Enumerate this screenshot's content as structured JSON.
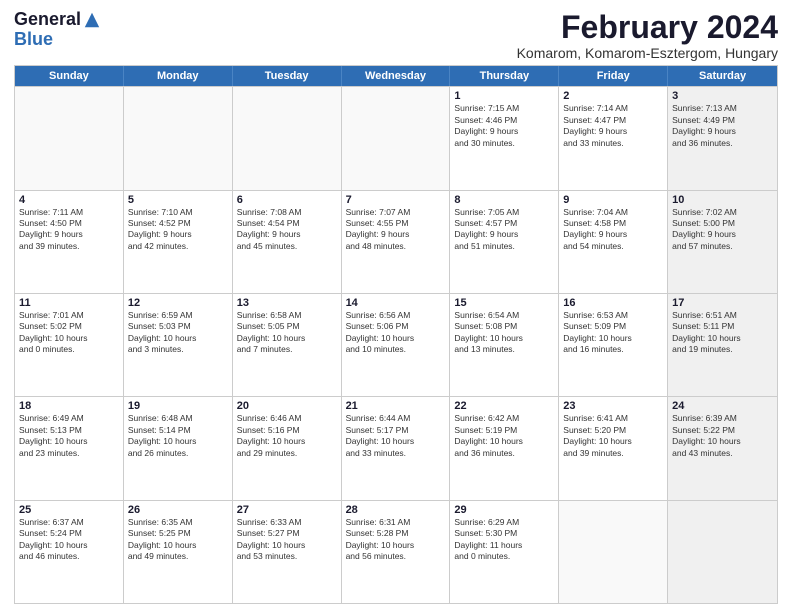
{
  "header": {
    "logo_line1": "General",
    "logo_line2": "Blue",
    "month_title": "February 2024",
    "subtitle": "Komarom, Komarom-Esztergom, Hungary"
  },
  "days_of_week": [
    "Sunday",
    "Monday",
    "Tuesday",
    "Wednesday",
    "Thursday",
    "Friday",
    "Saturday"
  ],
  "rows": [
    [
      {
        "day": "",
        "info": "",
        "empty": true
      },
      {
        "day": "",
        "info": "",
        "empty": true
      },
      {
        "day": "",
        "info": "",
        "empty": true
      },
      {
        "day": "",
        "info": "",
        "empty": true
      },
      {
        "day": "1",
        "info": "Sunrise: 7:15 AM\nSunset: 4:46 PM\nDaylight: 9 hours\nand 30 minutes."
      },
      {
        "day": "2",
        "info": "Sunrise: 7:14 AM\nSunset: 4:47 PM\nDaylight: 9 hours\nand 33 minutes."
      },
      {
        "day": "3",
        "info": "Sunrise: 7:13 AM\nSunset: 4:49 PM\nDaylight: 9 hours\nand 36 minutes.",
        "shaded": true
      }
    ],
    [
      {
        "day": "4",
        "info": "Sunrise: 7:11 AM\nSunset: 4:50 PM\nDaylight: 9 hours\nand 39 minutes."
      },
      {
        "day": "5",
        "info": "Sunrise: 7:10 AM\nSunset: 4:52 PM\nDaylight: 9 hours\nand 42 minutes."
      },
      {
        "day": "6",
        "info": "Sunrise: 7:08 AM\nSunset: 4:54 PM\nDaylight: 9 hours\nand 45 minutes."
      },
      {
        "day": "7",
        "info": "Sunrise: 7:07 AM\nSunset: 4:55 PM\nDaylight: 9 hours\nand 48 minutes."
      },
      {
        "day": "8",
        "info": "Sunrise: 7:05 AM\nSunset: 4:57 PM\nDaylight: 9 hours\nand 51 minutes."
      },
      {
        "day": "9",
        "info": "Sunrise: 7:04 AM\nSunset: 4:58 PM\nDaylight: 9 hours\nand 54 minutes."
      },
      {
        "day": "10",
        "info": "Sunrise: 7:02 AM\nSunset: 5:00 PM\nDaylight: 9 hours\nand 57 minutes.",
        "shaded": true
      }
    ],
    [
      {
        "day": "11",
        "info": "Sunrise: 7:01 AM\nSunset: 5:02 PM\nDaylight: 10 hours\nand 0 minutes."
      },
      {
        "day": "12",
        "info": "Sunrise: 6:59 AM\nSunset: 5:03 PM\nDaylight: 10 hours\nand 3 minutes."
      },
      {
        "day": "13",
        "info": "Sunrise: 6:58 AM\nSunset: 5:05 PM\nDaylight: 10 hours\nand 7 minutes."
      },
      {
        "day": "14",
        "info": "Sunrise: 6:56 AM\nSunset: 5:06 PM\nDaylight: 10 hours\nand 10 minutes."
      },
      {
        "day": "15",
        "info": "Sunrise: 6:54 AM\nSunset: 5:08 PM\nDaylight: 10 hours\nand 13 minutes."
      },
      {
        "day": "16",
        "info": "Sunrise: 6:53 AM\nSunset: 5:09 PM\nDaylight: 10 hours\nand 16 minutes."
      },
      {
        "day": "17",
        "info": "Sunrise: 6:51 AM\nSunset: 5:11 PM\nDaylight: 10 hours\nand 19 minutes.",
        "shaded": true
      }
    ],
    [
      {
        "day": "18",
        "info": "Sunrise: 6:49 AM\nSunset: 5:13 PM\nDaylight: 10 hours\nand 23 minutes."
      },
      {
        "day": "19",
        "info": "Sunrise: 6:48 AM\nSunset: 5:14 PM\nDaylight: 10 hours\nand 26 minutes."
      },
      {
        "day": "20",
        "info": "Sunrise: 6:46 AM\nSunset: 5:16 PM\nDaylight: 10 hours\nand 29 minutes."
      },
      {
        "day": "21",
        "info": "Sunrise: 6:44 AM\nSunset: 5:17 PM\nDaylight: 10 hours\nand 33 minutes."
      },
      {
        "day": "22",
        "info": "Sunrise: 6:42 AM\nSunset: 5:19 PM\nDaylight: 10 hours\nand 36 minutes."
      },
      {
        "day": "23",
        "info": "Sunrise: 6:41 AM\nSunset: 5:20 PM\nDaylight: 10 hours\nand 39 minutes."
      },
      {
        "day": "24",
        "info": "Sunrise: 6:39 AM\nSunset: 5:22 PM\nDaylight: 10 hours\nand 43 minutes.",
        "shaded": true
      }
    ],
    [
      {
        "day": "25",
        "info": "Sunrise: 6:37 AM\nSunset: 5:24 PM\nDaylight: 10 hours\nand 46 minutes."
      },
      {
        "day": "26",
        "info": "Sunrise: 6:35 AM\nSunset: 5:25 PM\nDaylight: 10 hours\nand 49 minutes."
      },
      {
        "day": "27",
        "info": "Sunrise: 6:33 AM\nSunset: 5:27 PM\nDaylight: 10 hours\nand 53 minutes."
      },
      {
        "day": "28",
        "info": "Sunrise: 6:31 AM\nSunset: 5:28 PM\nDaylight: 10 hours\nand 56 minutes."
      },
      {
        "day": "29",
        "info": "Sunrise: 6:29 AM\nSunset: 5:30 PM\nDaylight: 11 hours\nand 0 minutes."
      },
      {
        "day": "",
        "info": "",
        "empty": true
      },
      {
        "day": "",
        "info": "",
        "empty": true,
        "shaded": true
      }
    ]
  ]
}
